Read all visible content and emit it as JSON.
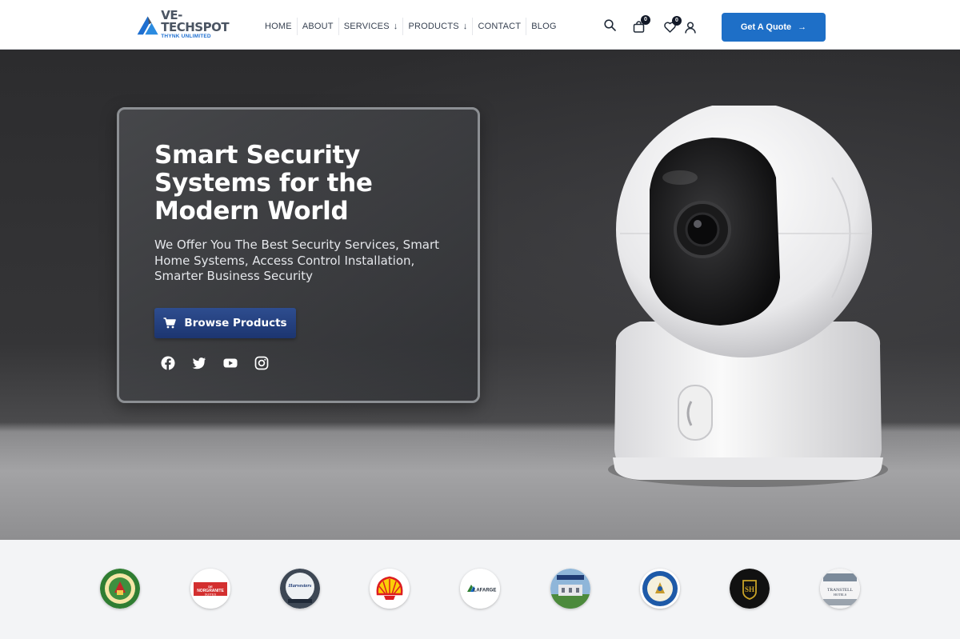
{
  "brand": {
    "name": "VE-TECHSPOT",
    "tagline": "THYNK UNLIMITED",
    "accent": "#1e6fc7"
  },
  "nav": {
    "items": [
      {
        "label": "HOME",
        "has_dropdown": false
      },
      {
        "label": "ABOUT",
        "has_dropdown": false
      },
      {
        "label": "SERVICES",
        "has_dropdown": true
      },
      {
        "label": "PRODUCTS",
        "has_dropdown": true
      },
      {
        "label": "CONTACT",
        "has_dropdown": false
      },
      {
        "label": "BLOG",
        "has_dropdown": false
      }
    ]
  },
  "header": {
    "cart_count": "0",
    "wishlist_count": "0",
    "quote_label": "Get A Quote"
  },
  "hero": {
    "title": "Smart Security Systems for the Modern World",
    "subtitle": "We Offer You The Best Security Services, Smart Home Systems, Access Control Installation, Smarter Business Security",
    "cta_label": "Browse Products",
    "socials": [
      "facebook-icon",
      "twitter-icon",
      "youtube-icon",
      "instagram-icon"
    ]
  },
  "clients": {
    "logo_texts": [
      "DE NORGRANITE SUITES",
      "Harvesters",
      "Shell",
      "LAFARGE",
      "SH",
      "TRANSTELL HOTELS"
    ]
  }
}
